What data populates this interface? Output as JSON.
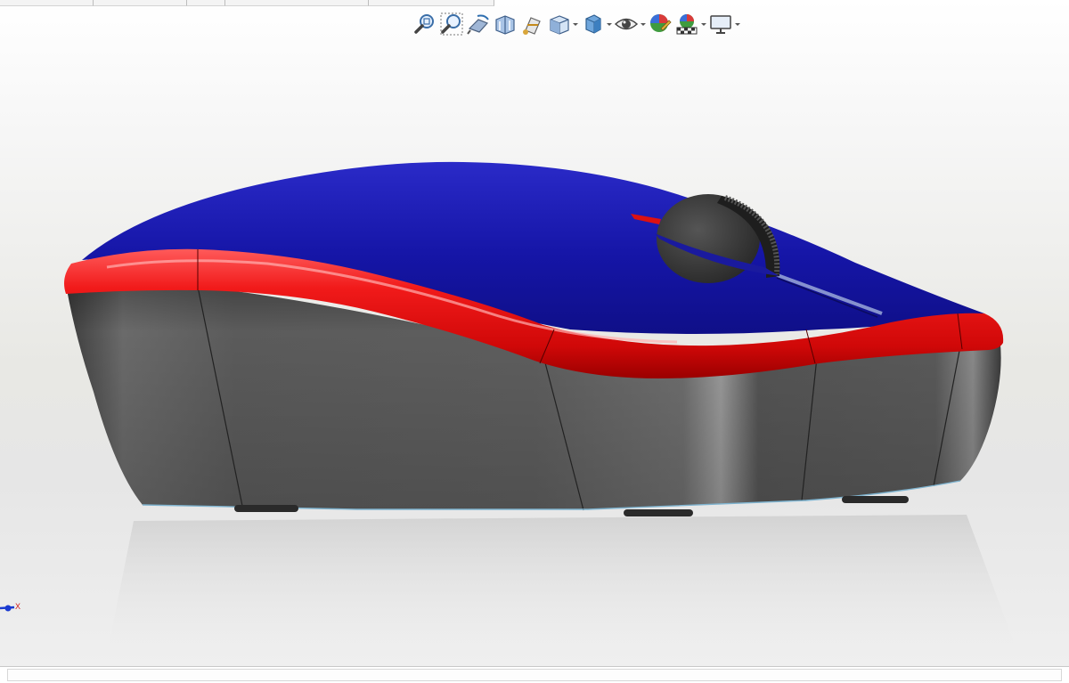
{
  "window": {
    "title": ""
  },
  "view_toolbar": {
    "tools": [
      {
        "icon": "zoom-to-fit-icon",
        "dropdown": false
      },
      {
        "icon": "zoom-to-area-icon",
        "dropdown": false
      },
      {
        "icon": "previous-view-icon",
        "dropdown": false
      },
      {
        "icon": "section-view-icon",
        "dropdown": false
      },
      {
        "icon": "dynamic-annotation-views-icon",
        "dropdown": false
      },
      {
        "icon": "view-orientation-icon",
        "dropdown": true
      },
      {
        "icon": "display-style-icon",
        "dropdown": true
      },
      {
        "icon": "hide-show-items-icon",
        "dropdown": true
      },
      {
        "icon": "edit-appearance-icon",
        "dropdown": false
      },
      {
        "icon": "apply-scene-icon",
        "dropdown": true
      },
      {
        "icon": "view-settings-icon",
        "dropdown": true
      }
    ]
  },
  "model": {
    "part": "computer-mouse",
    "colors": {
      "top_shell": "#1a1a9e",
      "accent_band": "#e50f0f",
      "body_sides": "#5a5a5a",
      "scroll_wheel": "#3a3a3a",
      "feet": "#2a2a2a"
    }
  },
  "triad": {
    "axis_label": "X"
  },
  "status_bar": {
    "text": ""
  }
}
